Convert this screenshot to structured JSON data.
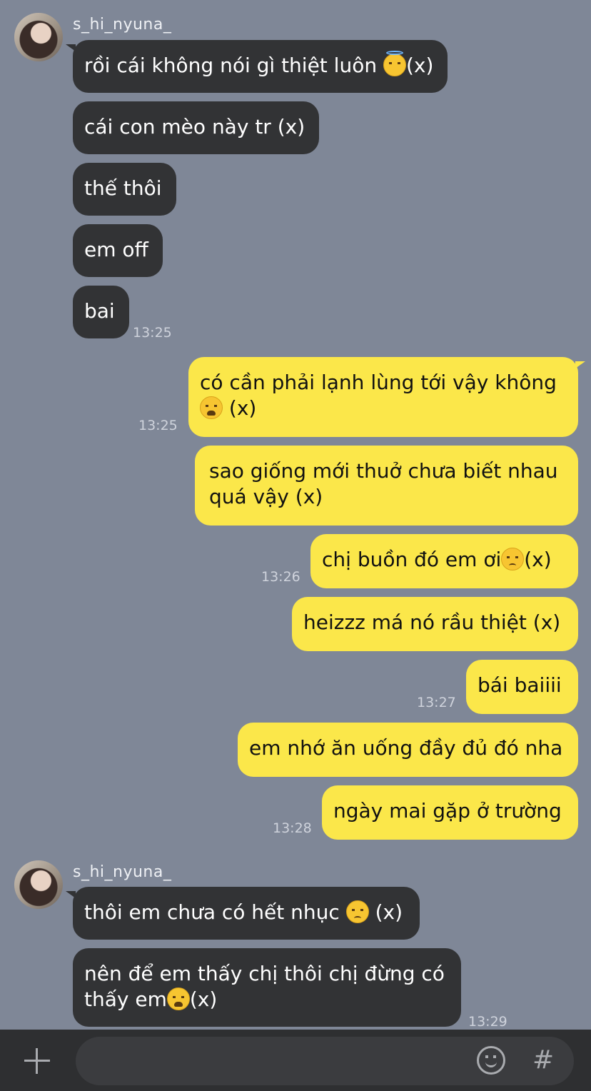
{
  "sender_name": "s_hi_nyuna_",
  "messages": {
    "m1": "rồi cái không nói gì thiệt luôn",
    "m1_tail": "(x)",
    "m2": "cái con mèo này tr (x)",
    "m3": "thế thôi",
    "m4": "em off",
    "m5": "bai",
    "t1": "13:25",
    "m6_line1": "có cần phải lạnh lùng tới vậy không",
    "m6_tail": "(x)",
    "t2": "13:25",
    "m7": "sao giống mới thuở chưa biết nhau quá vậy (x)",
    "m8": "chị buồn đó em ơi",
    "m8_tail": "(x)",
    "t3": "13:26",
    "m9": "heizzz má nó rầu thiệt (x)",
    "m10": "bái baiiii",
    "t4": "13:27",
    "m11": "em nhớ ăn uống đầy đủ đó nha",
    "m12": "ngày mai gặp ở trường",
    "t5": "13:28",
    "m13": "thôi em chưa có hết nhục",
    "m13_tail": "(x)",
    "m14_line1": "nên để em thấy chị thôi chị đừng có",
    "m14_line2": "thấy em",
    "m14_tail": "(x)",
    "t6": "13:29"
  },
  "icons": {
    "attach": "plus-icon",
    "emoji": "smile-icon",
    "hashtag": "hash-icon"
  },
  "colors": {
    "background": "#7f8797",
    "incoming_bubble": "#323335",
    "outgoing_bubble": "#fbe74a"
  }
}
